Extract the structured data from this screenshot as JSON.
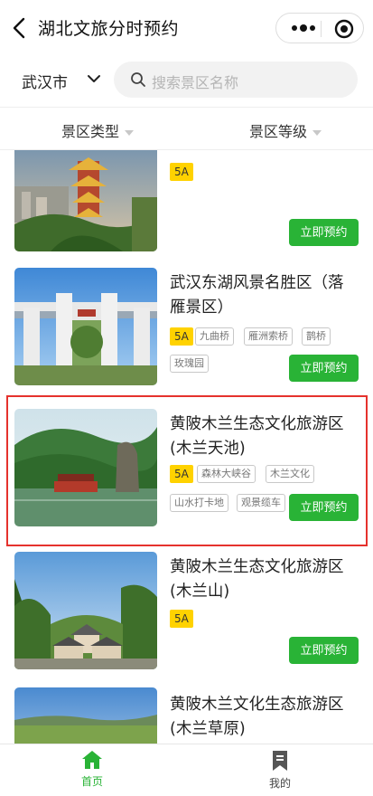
{
  "header": {
    "title": "湖北文旅分时预约"
  },
  "search": {
    "city": "武汉市",
    "placeholder": "搜索景区名称"
  },
  "filters": [
    {
      "label": "景区类型"
    },
    {
      "label": "景区等级"
    }
  ],
  "scenic_spots": [
    {
      "name": "",
      "level": "5A",
      "tags": [],
      "book_label": "立即预约"
    },
    {
      "name": "武汉东湖风景名胜区（落雁景区）",
      "level": "5A",
      "tags": [
        "九曲桥",
        "雁洲索桥",
        "鹊桥",
        "玫瑰园"
      ],
      "book_label": "立即预约"
    },
    {
      "name": "黄陂木兰生态文化旅游区(木兰天池)",
      "level": "5A",
      "tags": [
        "森林大峡谷",
        "木兰文化",
        "山水打卡地",
        "观景缆车"
      ],
      "book_label": "立即预约"
    },
    {
      "name": "黄陂木兰生态文化旅游区(木兰山)",
      "level": "5A",
      "tags": [],
      "book_label": "立即预约"
    },
    {
      "name": "黄陂木兰文化生态旅游区(木兰草原)",
      "level": "",
      "tags": [],
      "book_label": ""
    }
  ],
  "tabbar": [
    {
      "label": "首页",
      "active": true
    },
    {
      "label": "我的",
      "active": false
    }
  ],
  "colors": {
    "accent": "#29b336",
    "badge": "#ffd200",
    "highlight": "#e5322d"
  }
}
